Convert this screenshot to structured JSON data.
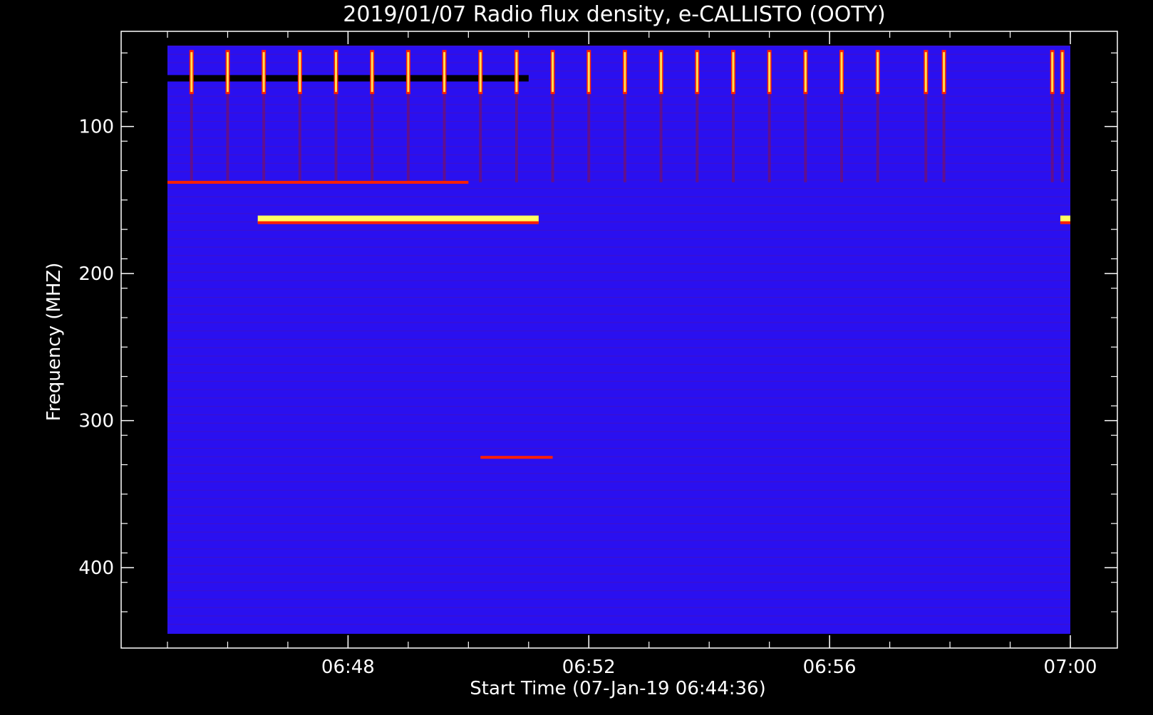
{
  "chart_data": {
    "type": "heatmap",
    "title": "2019/01/07  Radio flux density, e-CALLISTO (OOTY)",
    "xlabel": "Start Time (07-Jan-19 06:44:36)",
    "ylabel": "Frequency (MHZ)",
    "x_axis": {
      "unit": "time",
      "range": [
        "06:45:00",
        "07:00:00"
      ],
      "ticks": [
        "06:48",
        "06:52",
        "06:56",
        "07:00"
      ],
      "minor_tick_step_minutes": 1
    },
    "y_axis": {
      "unit": "MHz",
      "range": [
        45,
        445
      ],
      "reversed": true,
      "ticks": [
        100,
        200,
        300,
        400
      ],
      "minor_tick_step": 20
    },
    "colormap": {
      "background": "#2a10f0",
      "weak": "#a01020",
      "strong": "#ff2000",
      "peak": "#ffff60"
    },
    "features": {
      "periodic_bursts": {
        "times": [
          "06:45:24",
          "06:46:00",
          "06:46:36",
          "06:47:12",
          "06:47:48",
          "06:48:24",
          "06:49:00",
          "06:49:36",
          "06:50:12",
          "06:50:48",
          "06:51:24",
          "06:52:00",
          "06:52:36",
          "06:53:12",
          "06:53:48",
          "06:54:24",
          "06:55:00",
          "06:55:36",
          "06:56:12",
          "06:56:48",
          "06:57:36",
          "06:57:54",
          "06:59:42",
          "06:59:52"
        ],
        "freq_range_mhz": [
          48,
          78
        ],
        "description": "repeating broadband interference pulses"
      },
      "dark_band": {
        "freq_mhz": 67,
        "time_range": [
          "06:45:00",
          "06:51:00"
        ]
      },
      "rfi_lines": [
        {
          "freq_mhz": 138,
          "time_range": [
            "06:45:00",
            "06:50:00"
          ],
          "level": "strong"
        },
        {
          "freq_mhz": 163,
          "time_range": [
            "06:46:30",
            "06:51:10"
          ],
          "level": "peak"
        },
        {
          "freq_mhz": 163,
          "time_range": [
            "06:59:50",
            "07:00:00"
          ],
          "level": "peak"
        },
        {
          "freq_mhz": 325,
          "time_range": [
            "06:50:12",
            "06:51:24"
          ],
          "level": "strong"
        }
      ]
    }
  }
}
